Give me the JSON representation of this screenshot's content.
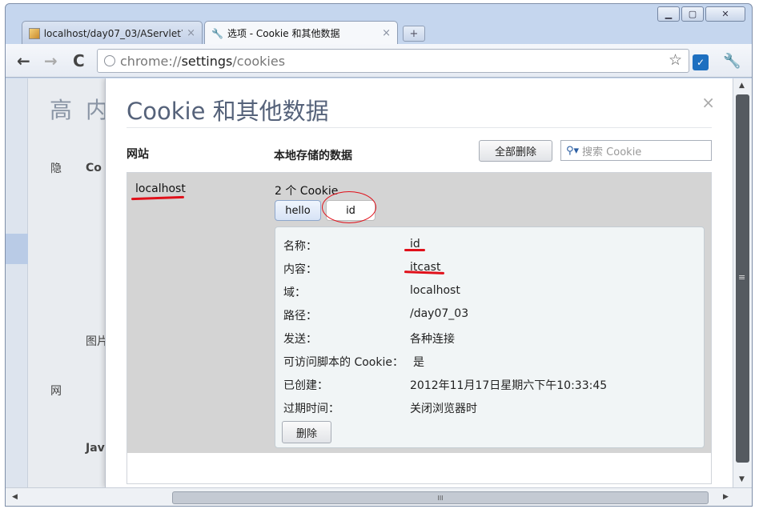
{
  "window": {
    "controls": [
      "▁",
      "▢",
      "✕"
    ]
  },
  "tabs": [
    {
      "title": "localhost/day07_03/AServlet?",
      "active": false,
      "close": "×"
    },
    {
      "title": "选项 - Cookie 和其他数据",
      "active": true,
      "close": "×"
    }
  ],
  "new_tab": "+",
  "toolbar": {
    "back": "←",
    "forward": "→",
    "reload": "C",
    "url_scheme": "chrome://",
    "url_host": "settings",
    "url_path": "/cookies",
    "star": "☆",
    "extension": "✓",
    "menu": "🔧"
  },
  "background": {
    "heading_a": "高",
    "heading_b": "内",
    "side_label_1": "隐",
    "section_1": "Co",
    "section_2": "图片",
    "side_label_2": "网",
    "section_3": "Jav"
  },
  "dialog": {
    "title": "Cookie 和其他数据",
    "close": "×",
    "col_site": "网站",
    "col_data": "本地存储的数据",
    "remove_all": "全部删除",
    "search_placeholder": "搜索 Cookie"
  },
  "entry": {
    "site": "localhost",
    "count": "2 个 Cookie",
    "cookies": [
      "hello",
      "id"
    ]
  },
  "details": {
    "name_label": "名称：",
    "name_value": "id",
    "content_label": "内容：",
    "content_value": "itcast",
    "domain_label": "域：",
    "domain_value": "localhost",
    "path_label": "路径：",
    "path_value": "/day07_03",
    "send_label": "发送：",
    "send_value": "各种连接",
    "script_label": "可访问脚本的 Cookie：",
    "script_value": "是",
    "created_label": "已创建：",
    "created_value": "2012年11月17日星期六下午10:33:45",
    "expires_label": "过期时间：",
    "expires_value": "关闭浏览器时",
    "delete": "删除"
  },
  "scrollbar": {
    "grip_h": "III",
    "grip_v": "≡"
  },
  "colors": {
    "annotation": "#e0101a",
    "selected_row": "#d4d4d4",
    "title": "#55627a"
  }
}
